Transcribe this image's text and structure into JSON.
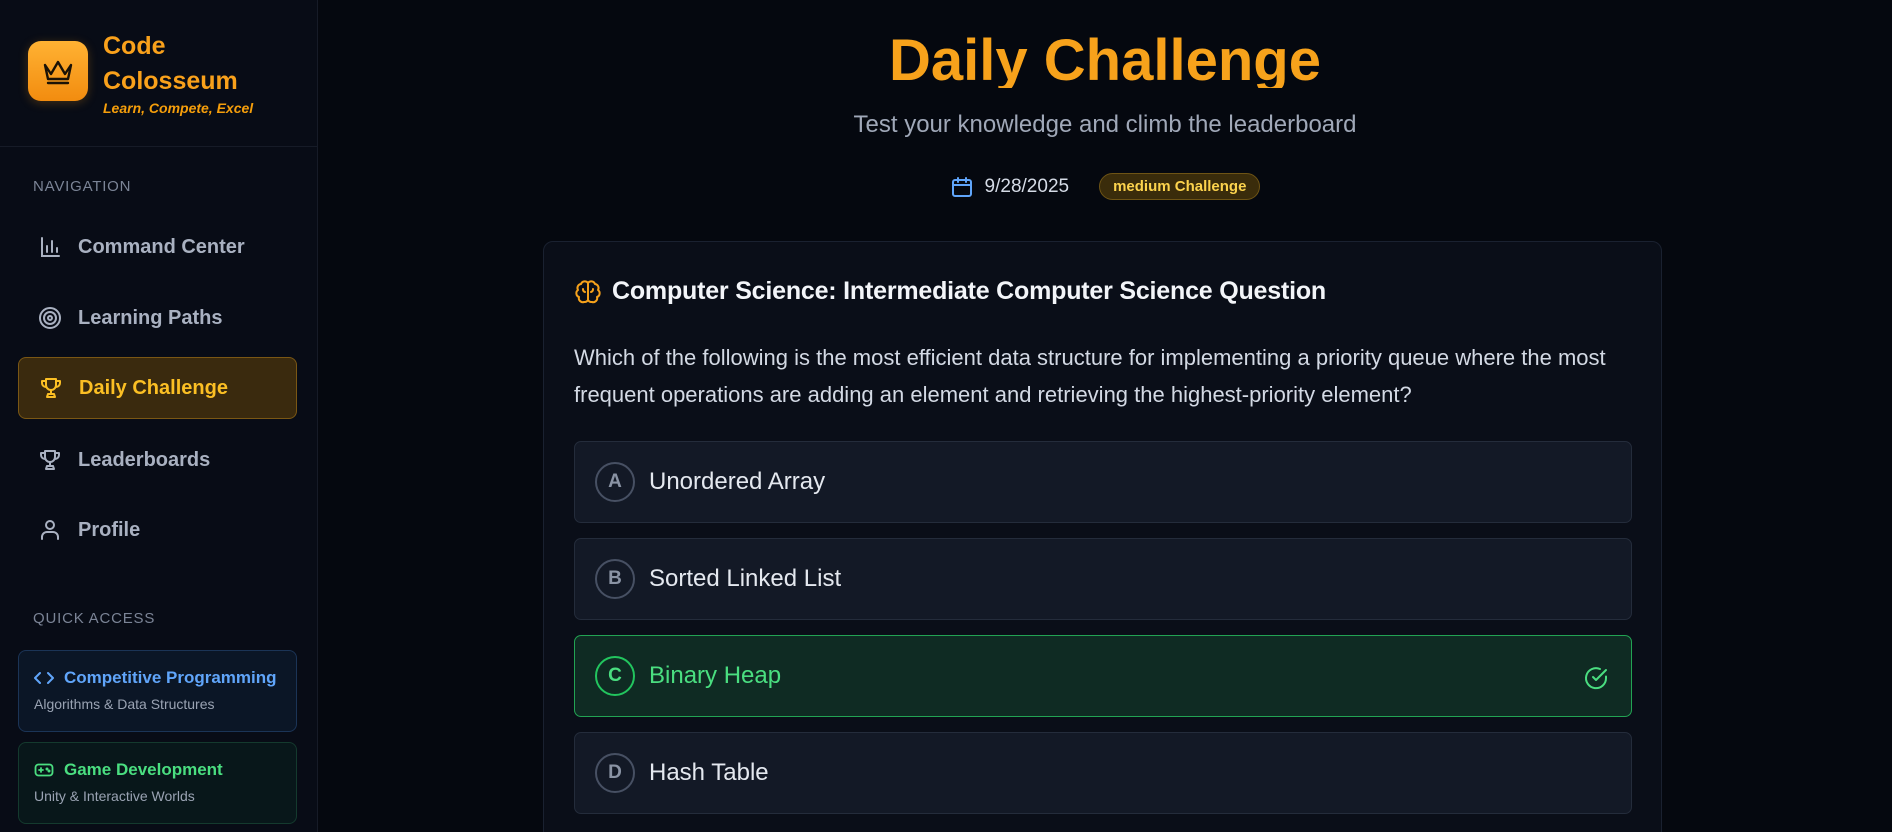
{
  "brand": {
    "name": "Code Colosseum",
    "tagline": "Learn, Compete, Excel"
  },
  "sidebar": {
    "nav_label": "NAVIGATION",
    "items": [
      {
        "label": "Command Center",
        "icon": "bar-chart-icon"
      },
      {
        "label": "Learning Paths",
        "icon": "target-icon"
      },
      {
        "label": "Daily Challenge",
        "icon": "trophy-icon",
        "active": true
      },
      {
        "label": "Leaderboards",
        "icon": "trophy-icon"
      },
      {
        "label": "Profile",
        "icon": "user-icon"
      }
    ],
    "quick_label": "QUICK ACCESS",
    "quick": [
      {
        "title": "Competitive Programming",
        "sub": "Algorithms & Data Structures",
        "icon": "code-icon",
        "color": "#60a5fa"
      },
      {
        "title": "Game Development",
        "sub": "Unity & Interactive Worlds",
        "icon": "gamepad-icon",
        "color": "#4ade80"
      }
    ]
  },
  "header": {
    "title": "Daily Challenge",
    "subtitle": "Test your knowledge and climb the leaderboard",
    "date": "9/28/2025",
    "difficulty": "medium Challenge"
  },
  "question": {
    "title": "Computer Science: Intermediate Computer Science Question",
    "text": "Which of the following is the most efficient data structure for implementing a priority queue where the most frequent operations are adding an element and retrieving the highest-priority element?",
    "options": [
      {
        "letter": "A",
        "label": "Unordered Array"
      },
      {
        "letter": "B",
        "label": "Sorted Linked List"
      },
      {
        "letter": "C",
        "label": "Binary Heap",
        "state": "correct"
      },
      {
        "letter": "D",
        "label": "Hash Table"
      }
    ]
  },
  "colors": {
    "accent": "#f7a21b",
    "correct": "#22c55e",
    "background": "#05080f"
  }
}
